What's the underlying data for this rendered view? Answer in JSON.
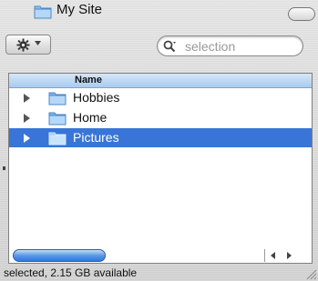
{
  "window": {
    "title": "My Site"
  },
  "toolbar": {
    "action_icon": "gear-icon",
    "search": {
      "value": "",
      "placeholder": "selection"
    }
  },
  "list": {
    "column_header": "Name",
    "items": [
      {
        "label": "Hobbies",
        "selected": false
      },
      {
        "label": "Home",
        "selected": false
      },
      {
        "label": "Pictures",
        "selected": true
      }
    ]
  },
  "status": {
    "text": "selected, 2.15 GB available"
  },
  "colors": {
    "selection": "#3875d7",
    "header": "#a9cbef",
    "folder": "#7fb3ea"
  }
}
